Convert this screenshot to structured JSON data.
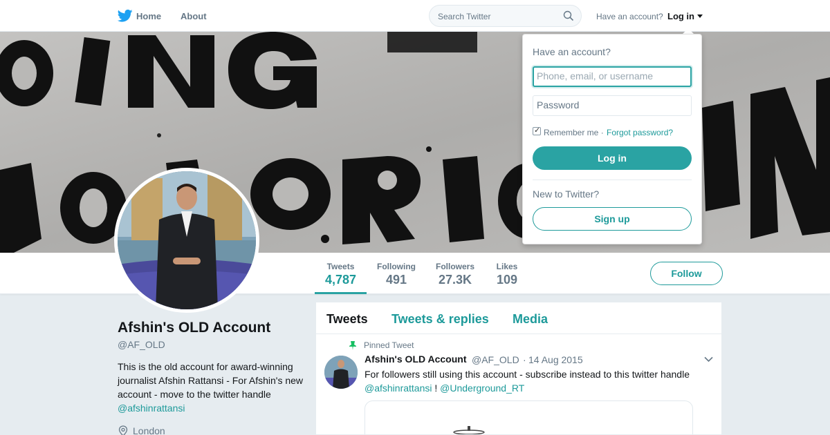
{
  "nav": {
    "home": "Home",
    "about": "About",
    "search_placeholder": "Search Twitter",
    "have_account": "Have an account?",
    "login": "Log in"
  },
  "profile": {
    "name": "Afshin's OLD Account",
    "handle": "@AF_OLD",
    "bio_text": "This is the old account for award-winning journalist Afshin Rattansi - For Afshin's new account - move to the twitter handle",
    "bio_link": "@afshinrattansi",
    "location": "London"
  },
  "stats": [
    {
      "label": "Tweets",
      "value": "4,787"
    },
    {
      "label": "Following",
      "value": "491"
    },
    {
      "label": "Followers",
      "value": "27.3K"
    },
    {
      "label": "Likes",
      "value": "109"
    }
  ],
  "follow_label": "Follow",
  "timeline": {
    "tabs": [
      "Tweets",
      "Tweets & replies",
      "Media"
    ],
    "pinned_label": "Pinned Tweet",
    "tweet": {
      "name": "Afshin's OLD Account",
      "handle": "@AF_OLD",
      "separator": "·",
      "date": "14 Aug 2015",
      "text": "For followers still using this account - subscribe instead to this twitter handle",
      "link1": "@afshinrattansi",
      "mid": " ! ",
      "link2": "@Underground_RT"
    }
  },
  "login_dropdown": {
    "title": "Have an account?",
    "username_placeholder": "Phone, email, or username",
    "password_placeholder": "Password",
    "remember": "Remember me ·",
    "forgot": "Forgot password?",
    "login_button": "Log in",
    "new_label": "New to Twitter?",
    "signup_button": "Sign up"
  },
  "colors": {
    "accent": "#2aa3a3",
    "link": "#1d9a9a",
    "background": "#e6ecf0"
  }
}
